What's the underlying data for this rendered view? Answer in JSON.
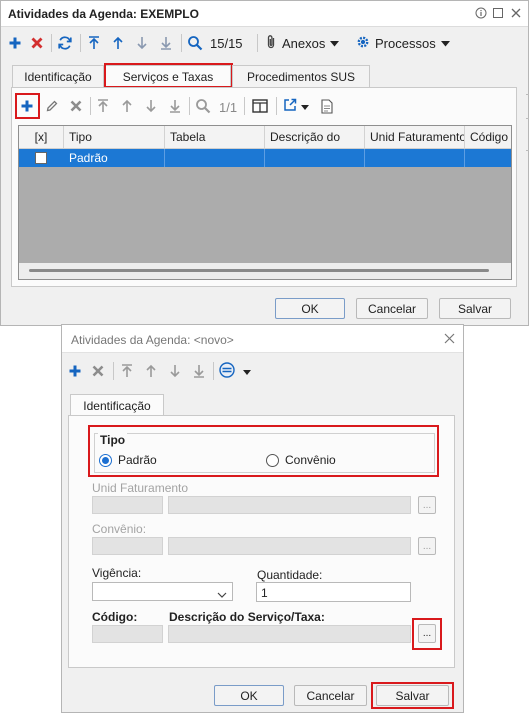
{
  "win1": {
    "title": "Atividades da Agenda: EXEMPLO",
    "record_counter": "15/15",
    "anexos_label": "Anexos",
    "processos_label": "Processos",
    "tabs": [
      "Identificação",
      "Serviços e Taxas",
      "Procedimentos SUS"
    ],
    "sub_counter": "1/1",
    "grid": {
      "headers": [
        "[x]",
        "Tipo",
        "Tabela",
        "Descrição do",
        "Unid Faturamento",
        "Código"
      ],
      "rows": [
        [
          "",
          "Padrão",
          "",
          "",
          "",
          ""
        ]
      ]
    },
    "buttons": {
      "ok": "OK",
      "cancel": "Cancelar",
      "save": "Salvar"
    }
  },
  "win2": {
    "title": "Atividades da Agenda: <novo>",
    "tab": "Identificação",
    "tipo": {
      "legend": "Tipo",
      "options": [
        "Padrão",
        "Convênio"
      ],
      "selected": "Padrão"
    },
    "fields": {
      "unid_faturamento_label": "Unid Faturamento",
      "convenio_label": "Convênio:",
      "vigencia_label": "Vigência:",
      "quantidade_label": "Quantidade:",
      "quantidade_value": "1",
      "codigo_label": "Código:",
      "descricao_label": "Descrição do Serviço/Taxa:",
      "browse_label": "..."
    },
    "buttons": {
      "ok": "OK",
      "cancel": "Cancelar",
      "save": "Salvar"
    }
  },
  "colors": {
    "accent_blue": "#1c78d4",
    "highlight_red": "#d9191c",
    "icon_add_blue": "#1565c0",
    "icon_delete_red": "#d32f2f"
  }
}
